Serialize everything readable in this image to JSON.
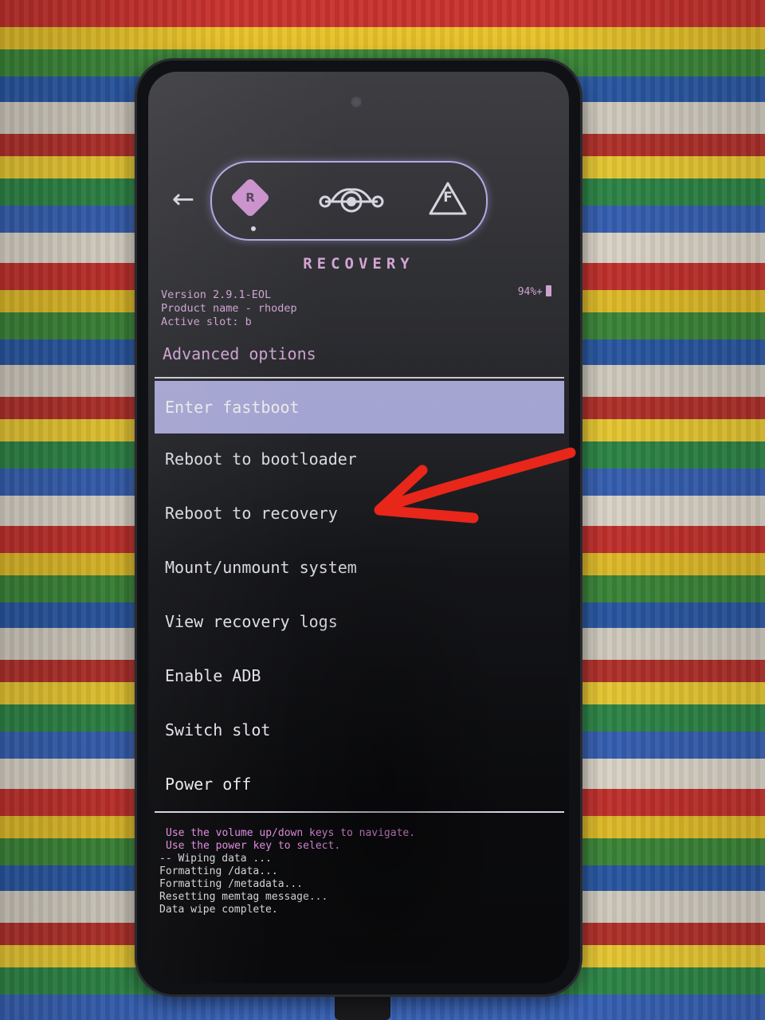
{
  "recovery": {
    "header": {
      "back_icon": "back-arrow-icon",
      "tabs": [
        {
          "icon": "recovery-diamond-icon",
          "letter": "R",
          "active": true
        },
        {
          "icon": "lineage-logo-icon"
        },
        {
          "icon": "fastboot-warning-icon",
          "letter": "F"
        }
      ],
      "title": "RECOVERY"
    },
    "info": {
      "version": "Version 2.9.1-EOL",
      "product": "Product name - rhodep",
      "slot": "Active slot: b",
      "battery": "94%+"
    },
    "section_title": "Advanced options",
    "menu": [
      {
        "label": "Enter fastboot",
        "selected": true
      },
      {
        "label": "Reboot to bootloader"
      },
      {
        "label": "Reboot to recovery"
      },
      {
        "label": "Mount/unmount system"
      },
      {
        "label": "View recovery logs"
      },
      {
        "label": "Enable ADB"
      },
      {
        "label": "Switch slot"
      },
      {
        "label": "Power off"
      }
    ],
    "hints": [
      "Use the volume up/down keys to navigate.",
      "Use the power key to select."
    ],
    "log": [
      "-- Wiping data ...",
      "Formatting /data...",
      "Formatting /metadata...",
      "Resetting memtag message...",
      "Data wipe complete."
    ]
  },
  "colors": {
    "accent": "#dca4dc",
    "selection": "#aaaadf",
    "annotation_arrow": "#e8261a"
  }
}
